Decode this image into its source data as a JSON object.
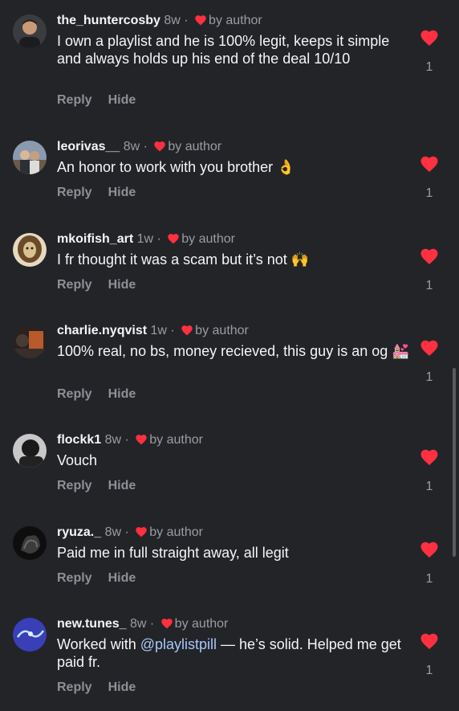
{
  "by_author": "by author",
  "reply_label": "Reply",
  "hide_label": "Hide",
  "like_color": "#ff3040",
  "comments": [
    {
      "username": "the_huntercosby",
      "age": "8w",
      "text": "I own a playlist and he is 100% legit, keeps it simple and always holds up his end of the deal 10/10",
      "likes": "1"
    },
    {
      "username": "leorivas__",
      "age": "8w",
      "text": "An honor to work with you brother 👌",
      "likes": "1"
    },
    {
      "username": "mkoifish_art",
      "age": "1w",
      "text": "I fr thought it was a scam but it’s not 🙌",
      "likes": "1"
    },
    {
      "username": "charlie.nyqvist",
      "age": "1w",
      "text": "100% real, no bs, money recieved, this guy is an og 💒",
      "likes": "1"
    },
    {
      "username": "flockk1",
      "age": "8w",
      "text": "Vouch",
      "likes": "1"
    },
    {
      "username": "ryuza._",
      "age": "8w",
      "text": "Paid me in full straight away, all legit",
      "likes": "1"
    },
    {
      "username": "new.tunes_",
      "age": "8w",
      "text_before": "Worked with ",
      "mention": "@playlistpill",
      "text_after": " — he’s solid. Helped me get paid fr.",
      "likes": "1"
    }
  ]
}
